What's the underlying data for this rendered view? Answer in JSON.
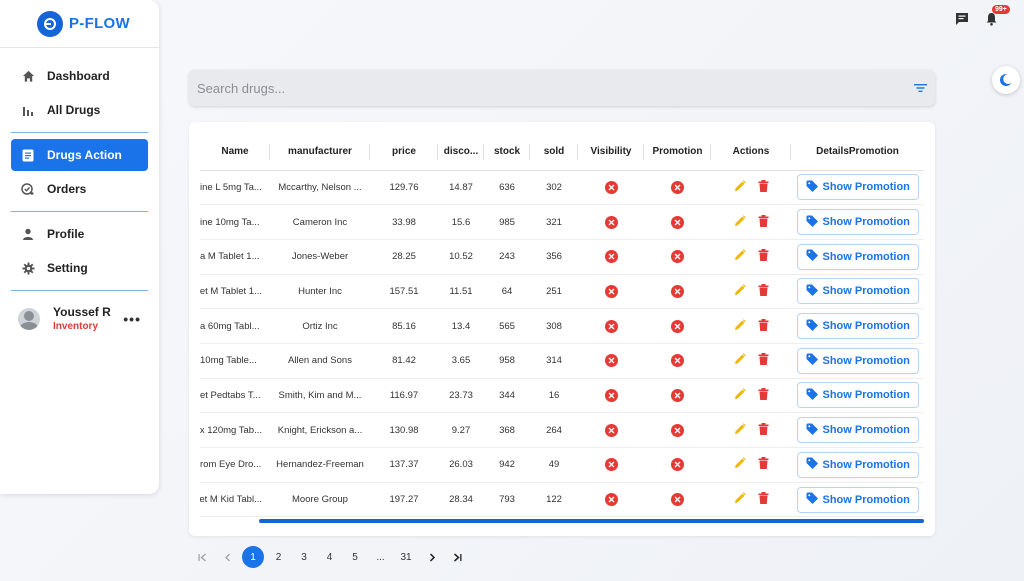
{
  "brand": {
    "name": "P-FLOW",
    "accent": "#1a73e8"
  },
  "sidebar": {
    "items": [
      {
        "label": "Dashboard",
        "icon": "home-icon"
      },
      {
        "label": "All Drugs",
        "icon": "bar-chart-icon"
      },
      {
        "label": "Drugs Action",
        "icon": "document-icon",
        "active": true
      },
      {
        "label": "Orders",
        "icon": "cart-check-icon"
      },
      {
        "label": "Profile",
        "icon": "person-icon"
      },
      {
        "label": "Setting",
        "icon": "gear-icon"
      }
    ],
    "user": {
      "name": "Youssef R",
      "role": "Inventory"
    }
  },
  "header": {
    "notification_badge": "99+"
  },
  "search": {
    "placeholder": "Search drugs..."
  },
  "table": {
    "columns": [
      "Name",
      "manufacturer",
      "price",
      "disco...",
      "stock",
      "sold",
      "Visibility",
      "Promotion",
      "Actions",
      "DetailsPromotion"
    ],
    "promo_label": "Show Promotion",
    "rows": [
      {
        "name": "ine L 5mg Ta...",
        "manufacturer": "Mccarthy, Nelson ...",
        "price": "129.76",
        "discount": "14.87",
        "stock": "636",
        "sold": "302"
      },
      {
        "name": "ine 10mg Ta...",
        "manufacturer": "Cameron Inc",
        "price": "33.98",
        "discount": "15.6",
        "stock": "985",
        "sold": "321"
      },
      {
        "name": "a M Tablet 1...",
        "manufacturer": "Jones-Weber",
        "price": "28.25",
        "discount": "10.52",
        "stock": "243",
        "sold": "356"
      },
      {
        "name": "et M Tablet 1...",
        "manufacturer": "Hunter Inc",
        "price": "157.51",
        "discount": "11.51",
        "stock": "64",
        "sold": "251"
      },
      {
        "name": "a 60mg Tabl...",
        "manufacturer": "Ortiz Inc",
        "price": "85.16",
        "discount": "13.4",
        "stock": "565",
        "sold": "308"
      },
      {
        "name": "10mg Table...",
        "manufacturer": "Allen and Sons",
        "price": "81.42",
        "discount": "3.65",
        "stock": "958",
        "sold": "314"
      },
      {
        "name": "et Pedtabs T...",
        "manufacturer": "Smith, Kim and M...",
        "price": "116.97",
        "discount": "23.73",
        "stock": "344",
        "sold": "16"
      },
      {
        "name": "x 120mg Tab...",
        "manufacturer": "Knight, Erickson a...",
        "price": "130.98",
        "discount": "9.27",
        "stock": "368",
        "sold": "264"
      },
      {
        "name": "rom Eye Dro...",
        "manufacturer": "Hernandez-Freeman",
        "price": "137.37",
        "discount": "26.03",
        "stock": "942",
        "sold": "49"
      },
      {
        "name": "et M Kid Tabl...",
        "manufacturer": "Moore Group",
        "price": "197.27",
        "discount": "28.34",
        "stock": "793",
        "sold": "122"
      }
    ]
  },
  "pagination": {
    "pages": [
      "1",
      "2",
      "3",
      "4",
      "5",
      "...",
      "31"
    ],
    "current": "1"
  }
}
